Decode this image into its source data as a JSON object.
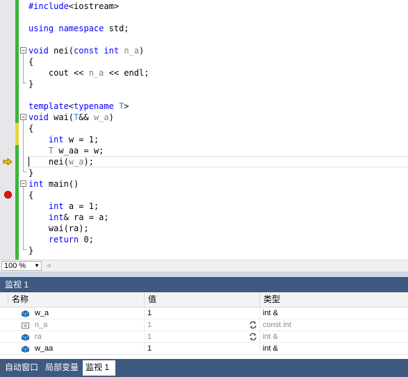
{
  "editor": {
    "lines": [
      {
        "html": "<span class=\"kw\">#include</span>&lt;iostream&gt;"
      },
      {
        "html": ""
      },
      {
        "html": "<span class=\"kw\">using</span> <span class=\"kw\">namespace</span> std;"
      },
      {
        "html": ""
      },
      {
        "html": "<span class=\"kw\">void</span> nei(<span class=\"kw\">const</span> <span class=\"kw\">int</span> <span class=\"pm\">n_a</span>)"
      },
      {
        "html": "{"
      },
      {
        "html": "    cout &lt;&lt; <span class=\"pm\">n_a</span> &lt;&lt; endl;"
      },
      {
        "html": "}"
      },
      {
        "html": ""
      },
      {
        "html": "<span class=\"kw\">template</span>&lt;<span class=\"kw\">typename</span> <span class=\"ty\">T</span>&gt;"
      },
      {
        "html": "<span class=\"kw\">void</span> wai(<span class=\"ty\">T</span>&amp;&amp; <span class=\"pm\">w_a</span>)"
      },
      {
        "html": "{"
      },
      {
        "html": "    <span class=\"kw\">int</span> w = 1;"
      },
      {
        "html": "    <span class=\"ty\">T</span> w_aa = w;"
      },
      {
        "html": "    nei(<span class=\"pm\">w_a</span>);"
      },
      {
        "html": "}"
      },
      {
        "html": "<span class=\"kw\">int</span> main()"
      },
      {
        "html": "{"
      },
      {
        "html": "    <span class=\"kw\">int</span> a = 1;"
      },
      {
        "html": "    <span class=\"kw\">int</span>&amp; ra = a;"
      },
      {
        "html": "    wai(ra);"
      },
      {
        "html": "    <span class=\"kw\">return</span> 0;"
      },
      {
        "html": "}"
      }
    ],
    "colors": {
      "keyword": "#0000ff",
      "type": "#2b91af",
      "param": "#808080",
      "saved_bar": "#3cb43c",
      "changed_bar": "#e8d63a",
      "breakpoint": "#e51400",
      "arrow": "#f5c000"
    }
  },
  "zoom": {
    "value": "100 %"
  },
  "watch": {
    "title": "监视 1",
    "columns": {
      "name": "名称",
      "value": "值",
      "type": "类型"
    },
    "rows": [
      {
        "name": "w_a",
        "value": "1",
        "type": "int &",
        "icon": "variable-icon",
        "dim": false,
        "refresh": false
      },
      {
        "name": "n_a",
        "value": "1",
        "type": "const int",
        "icon": "constant-icon",
        "dim": true,
        "refresh": true
      },
      {
        "name": "ra",
        "value": "1",
        "type": "int &",
        "icon": "variable-icon",
        "dim": true,
        "refresh": true
      },
      {
        "name": "w_aa",
        "value": "1",
        "type": "int &",
        "icon": "variable-icon",
        "dim": false,
        "refresh": false
      }
    ]
  },
  "tabs": [
    {
      "label": "自动窗口",
      "active": false
    },
    {
      "label": "局部变量",
      "active": false
    },
    {
      "label": "监视 1",
      "active": true
    }
  ]
}
